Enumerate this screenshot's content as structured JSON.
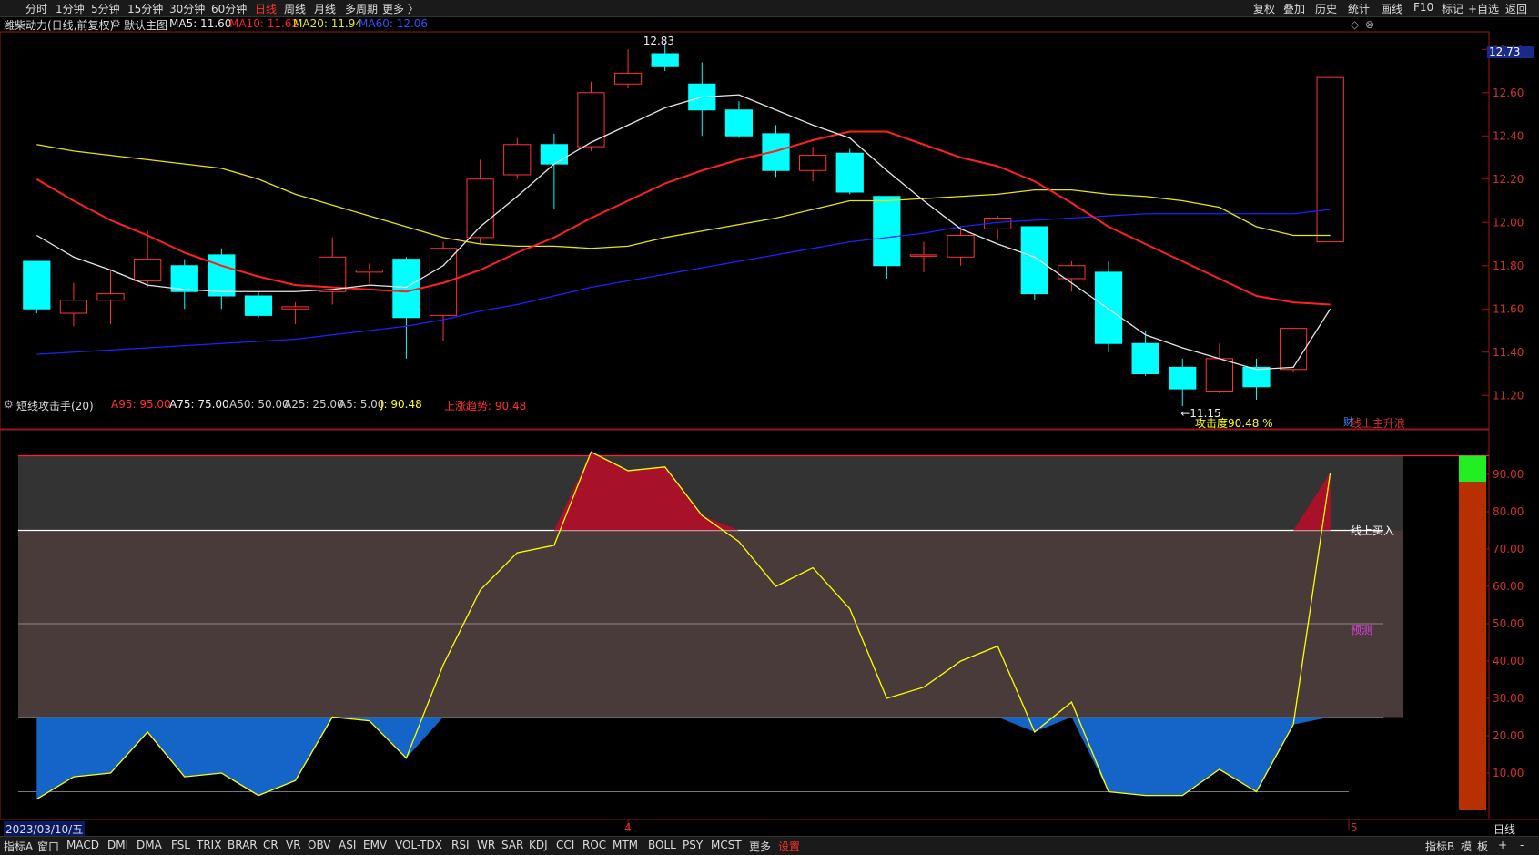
{
  "toolbar": {
    "periods": [
      "分时",
      "1分钟",
      "5分钟",
      "15分钟",
      "30分钟",
      "60分钟",
      "日线",
      "周线",
      "月线",
      "多周期",
      "更多 〉"
    ],
    "active_period": "日线",
    "right_items": [
      "复权",
      "叠加",
      "历史",
      "统计",
      "画线",
      "F10",
      "标记",
      "+自选",
      "返回"
    ]
  },
  "main_info": {
    "stock": "潍柴动力(日线,前复权)",
    "main_chart": "默认主图",
    "ma5": "MA5: 11.60",
    "ma10": "MA10: 11.62",
    "ma20": "MA20: 11.94",
    "ma60": "MA60: 12.06"
  },
  "sub_info": {
    "name": "短线攻击手(20)",
    "a95": "A95: 95.00",
    "a75": "A75: 75.00",
    "a50": "A50: 50.00",
    "a25": "A25: 25.00",
    "a5": "A5: 5.00",
    "j": "J: 90.48",
    "trend": "上涨趋势: 90.48"
  },
  "annotations": {
    "high": "12.83",
    "low": "11.15",
    "attack": "攻击度90.48 %",
    "line_top": "线上主升浪",
    "buy": "线上买入",
    "predict": "预测",
    "cai": "财",
    "last_price": "12.73"
  },
  "date_label": "2023/03/10/五",
  "month_marks": [
    "4",
    "5"
  ],
  "bottom_bar": {
    "items": [
      "指标A",
      "窗口",
      "MACD",
      "DMI",
      "DMA",
      "FSL",
      "TRIX",
      "BRAR",
      "CR",
      "VR",
      "OBV",
      "ASI",
      "EMV",
      "VOL-TDX",
      "RSI",
      "WR",
      "SAR",
      "KDJ",
      "CCI",
      "ROC",
      "MTM",
      "BOLL",
      "PSY",
      "MCST",
      "更多",
      "设置"
    ],
    "active": "设置",
    "right": [
      "指标B",
      "模",
      "板",
      "+",
      "-"
    ]
  },
  "side_label": "日线",
  "colors": {
    "up": "#ff3232",
    "down": "#00ffff",
    "ma5": "#e6e6e6",
    "ma10": "#ff2020",
    "ma20": "#e6e600",
    "ma60": "#2020ff",
    "jline": "#ffff00",
    "redfill": "#a8112a",
    "bluefill": "#1565c8"
  },
  "chart_data": [
    {
      "type": "candlestick",
      "ylim": [
        11.1,
        12.86
      ],
      "yticks": [
        11.2,
        11.4,
        11.6,
        11.8,
        12.0,
        12.2,
        12.4,
        12.6,
        12.8
      ],
      "candles": [
        {
          "o": 11.82,
          "c": 11.6,
          "h": 11.82,
          "l": 11.58
        },
        {
          "o": 11.58,
          "c": 11.64,
          "h": 11.72,
          "l": 11.52
        },
        {
          "o": 11.64,
          "c": 11.67,
          "h": 11.78,
          "l": 11.53
        },
        {
          "o": 11.73,
          "c": 11.83,
          "h": 11.96,
          "l": 11.7
        },
        {
          "o": 11.8,
          "c": 11.68,
          "h": 11.83,
          "l": 11.6
        },
        {
          "o": 11.85,
          "c": 11.66,
          "h": 11.88,
          "l": 11.6
        },
        {
          "o": 11.66,
          "c": 11.57,
          "h": 11.68,
          "l": 11.56
        },
        {
          "o": 11.6,
          "c": 11.61,
          "h": 11.63,
          "l": 11.53
        },
        {
          "o": 11.68,
          "c": 11.84,
          "h": 11.93,
          "l": 11.62
        },
        {
          "o": 11.77,
          "c": 11.78,
          "h": 11.81,
          "l": 11.72
        },
        {
          "o": 11.83,
          "c": 11.56,
          "h": 11.84,
          "l": 11.37
        },
        {
          "o": 11.57,
          "c": 11.88,
          "h": 11.91,
          "l": 11.45
        },
        {
          "o": 11.93,
          "c": 12.2,
          "h": 12.29,
          "l": 11.9
        },
        {
          "o": 12.22,
          "c": 12.36,
          "h": 12.39,
          "l": 12.2
        },
        {
          "o": 12.36,
          "c": 12.27,
          "h": 12.41,
          "l": 12.06
        },
        {
          "o": 12.35,
          "c": 12.6,
          "h": 12.65,
          "l": 12.33
        },
        {
          "o": 12.64,
          "c": 12.69,
          "h": 12.8,
          "l": 12.62
        },
        {
          "o": 12.78,
          "c": 12.72,
          "h": 12.83,
          "l": 12.7
        },
        {
          "o": 12.64,
          "c": 12.52,
          "h": 12.74,
          "l": 12.4
        },
        {
          "o": 12.52,
          "c": 12.4,
          "h": 12.56,
          "l": 12.39
        },
        {
          "o": 12.41,
          "c": 12.24,
          "h": 12.45,
          "l": 12.21
        },
        {
          "o": 12.24,
          "c": 12.31,
          "h": 12.35,
          "l": 12.19
        },
        {
          "o": 12.32,
          "c": 12.14,
          "h": 12.34,
          "l": 12.13
        },
        {
          "o": 12.12,
          "c": 11.8,
          "h": 12.12,
          "l": 11.74
        },
        {
          "o": 11.85,
          "c": 11.85,
          "h": 11.91,
          "l": 11.77
        },
        {
          "o": 11.84,
          "c": 11.94,
          "h": 11.98,
          "l": 11.8
        },
        {
          "o": 11.97,
          "c": 12.02,
          "h": 12.03,
          "l": 11.92
        },
        {
          "o": 11.98,
          "c": 11.67,
          "h": 11.98,
          "l": 11.64
        },
        {
          "o": 11.74,
          "c": 11.8,
          "h": 11.82,
          "l": 11.68
        },
        {
          "o": 11.77,
          "c": 11.44,
          "h": 11.82,
          "l": 11.4
        },
        {
          "o": 11.44,
          "c": 11.3,
          "h": 11.5,
          "l": 11.29
        },
        {
          "o": 11.33,
          "c": 11.23,
          "h": 11.37,
          "l": 11.15
        },
        {
          "o": 11.22,
          "c": 11.37,
          "h": 11.44,
          "l": 11.21
        },
        {
          "o": 11.33,
          "c": 11.24,
          "h": 11.37,
          "l": 11.18
        },
        {
          "o": 11.32,
          "c": 11.51,
          "h": 11.51,
          "l": 11.31
        },
        {
          "o": 11.91,
          "c": 12.67,
          "h": 12.67,
          "l": 11.91
        }
      ],
      "ma5": [
        11.94,
        11.84,
        11.78,
        11.71,
        11.69,
        11.68,
        11.68,
        11.68,
        11.69,
        11.71,
        11.7,
        11.8,
        11.98,
        12.12,
        12.27,
        12.37,
        12.45,
        12.53,
        12.58,
        12.59,
        12.52,
        12.45,
        12.39,
        12.24,
        12.1,
        11.97,
        11.9,
        11.84,
        11.72,
        11.6,
        11.48,
        11.42,
        11.37,
        11.32,
        11.33,
        11.6
      ],
      "ma10": [
        12.2,
        12.1,
        12.01,
        11.94,
        11.86,
        11.8,
        11.75,
        11.71,
        11.7,
        11.69,
        11.68,
        11.72,
        11.78,
        11.86,
        11.93,
        12.02,
        12.1,
        12.18,
        12.24,
        12.29,
        12.33,
        12.38,
        12.42,
        12.42,
        12.36,
        12.3,
        12.26,
        12.19,
        12.09,
        11.98,
        11.9,
        11.82,
        11.74,
        11.66,
        11.63,
        11.62
      ],
      "ma20": [
        12.36,
        12.33,
        12.31,
        12.29,
        12.27,
        12.25,
        12.2,
        12.13,
        12.08,
        12.03,
        11.98,
        11.93,
        11.9,
        11.89,
        11.89,
        11.88,
        11.89,
        11.93,
        11.96,
        11.99,
        12.02,
        12.06,
        12.1,
        12.1,
        12.11,
        12.12,
        12.13,
        12.15,
        12.15,
        12.13,
        12.12,
        12.1,
        12.07,
        11.98,
        11.94,
        11.94
      ],
      "ma60": [
        11.39,
        11.4,
        11.41,
        11.42,
        11.43,
        11.44,
        11.45,
        11.46,
        11.48,
        11.5,
        11.52,
        11.55,
        11.59,
        11.62,
        11.66,
        11.7,
        11.73,
        11.76,
        11.79,
        11.82,
        11.85,
        11.88,
        11.91,
        11.93,
        11.95,
        11.98,
        12.0,
        12.01,
        12.02,
        12.03,
        12.04,
        12.04,
        12.04,
        12.04,
        12.04,
        12.06
      ]
    },
    {
      "type": "line",
      "name": "短线攻击手",
      "ylim": [
        0,
        100
      ],
      "yticks": [
        10,
        20,
        30,
        40,
        50,
        60,
        70,
        80,
        90
      ],
      "levels": [
        95,
        75,
        50,
        25,
        5
      ],
      "j": [
        3,
        9,
        10,
        21,
        9,
        10,
        4,
        8,
        25,
        24,
        14,
        39,
        59,
        69,
        71,
        96,
        91,
        92,
        79,
        72,
        60,
        65,
        54,
        30,
        33,
        40,
        44,
        21,
        29,
        5,
        4,
        4,
        11,
        5,
        23,
        90.48
      ]
    }
  ]
}
